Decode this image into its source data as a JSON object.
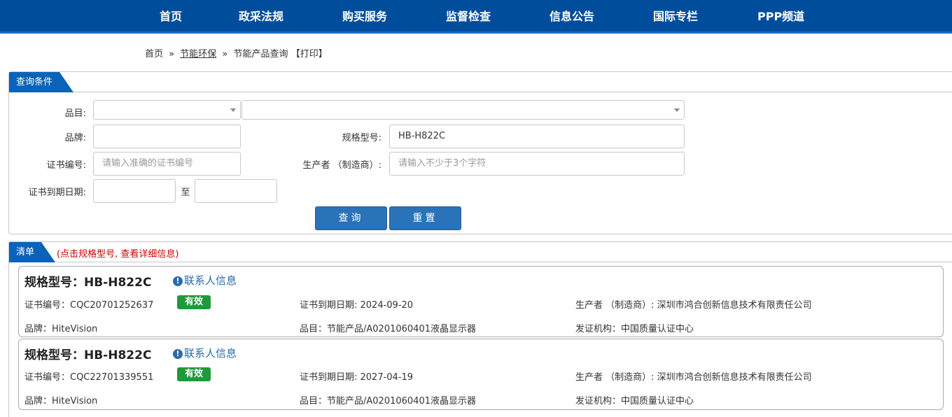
{
  "nav": [
    "首页",
    "政采法规",
    "购买服务",
    "监督检查",
    "信息公告",
    "国际专栏",
    "PPP频道"
  ],
  "breadcrumb": {
    "home": "首页",
    "sep": "»",
    "section": "节能环保",
    "page": "节能产品查询",
    "print": "【打印】"
  },
  "query": {
    "tab": "查询条件",
    "category_label": "品目:",
    "category_value_1": "",
    "category_value_2": "",
    "brand_label": "品牌:",
    "brand_value": "",
    "model_label": "规格型号:",
    "model_value": "HB-H822C",
    "cert_label": "证书编号:",
    "cert_placeholder": "请输入准确的证书编号",
    "maker_label": "生产者 （制造商）:",
    "maker_placeholder": "请输入不少于3个字符",
    "expiry_label": "证书到期日期:",
    "expiry_to": "至",
    "expiry_from_value": "",
    "expiry_to_value": "",
    "search_button": "查询",
    "reset_button": "重置"
  },
  "list": {
    "tab": "清单",
    "hint": "(点击规格型号, 查看详细信息)",
    "items": [
      {
        "model": "规格型号：HB-H822C",
        "contact": "联系人信息",
        "cert": "证书编号：CQC20701252637",
        "status": "有效",
        "expiry": "证书到期日期: 2024-09-20",
        "maker": "生产者 （制造商）: 深圳市鸿合创新信息技术有限责任公司",
        "brand": "品牌：HiteVision",
        "category": "品目：节能产品/A0201060401液晶显示器",
        "issuer": "发证机构：中国质量认证中心"
      },
      {
        "model": "规格型号：HB-H822C",
        "contact": "联系人信息",
        "cert": "证书编号：CQC22701339551",
        "status": "有效",
        "expiry": "证书到期日期: 2027-04-19",
        "maker": "生产者 （制造商）: 深圳市鸿合创新信息技术有限责任公司",
        "brand": "品牌：HiteVision",
        "category": "品目：节能产品/A0201060401液晶显示器",
        "issuer": "发证机构：中国质量认证中心"
      }
    ]
  },
  "colors": {
    "nav_bg": "#004d9b",
    "tab_bg": "#0a63b8",
    "button_bg": "#2b73b8",
    "valid_badge": "#1e9a3b",
    "hint_red": "#cc0000"
  },
  "icons": {
    "contact": "info-circle-icon",
    "select": "chevron-down-icon"
  }
}
